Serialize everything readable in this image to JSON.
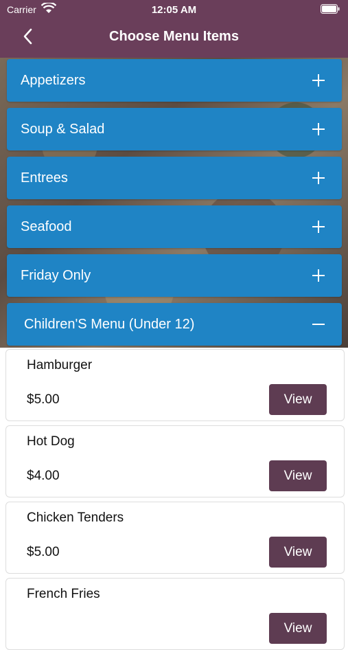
{
  "status": {
    "carrier": "Carrier",
    "time": "12:05 AM"
  },
  "nav": {
    "title": "Choose Menu Items"
  },
  "categories": [
    {
      "label": "Appetizers",
      "expanded": false
    },
    {
      "label": "Soup & Salad",
      "expanded": false
    },
    {
      "label": "Entrees",
      "expanded": false
    },
    {
      "label": "Seafood",
      "expanded": false
    },
    {
      "label": "Friday Only",
      "expanded": false
    },
    {
      "label": "Children'S Menu (Under 12)",
      "expanded": true
    }
  ],
  "items": [
    {
      "name": "Hamburger",
      "price": "$5.00",
      "button": "View"
    },
    {
      "name": "Hot Dog",
      "price": "$4.00",
      "button": "View"
    },
    {
      "name": "Chicken Tenders",
      "price": "$5.00",
      "button": "View"
    },
    {
      "name": "French Fries",
      "price": "",
      "button": "View"
    }
  ],
  "colors": {
    "header": "#6a3e5a",
    "category": "#1f84c5",
    "view_button": "#5e3c52"
  }
}
